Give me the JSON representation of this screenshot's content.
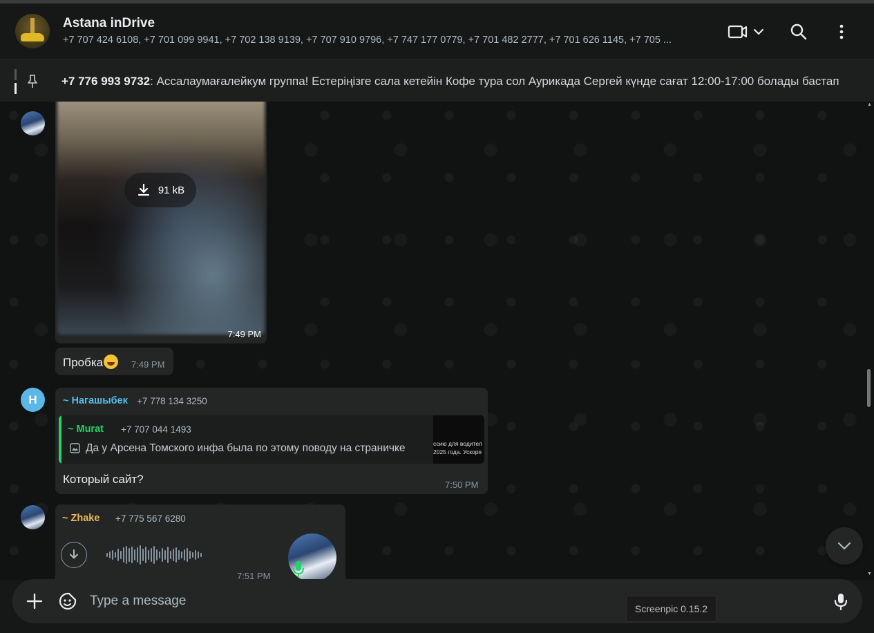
{
  "header": {
    "title": "Astana inDrive",
    "members": "+7 707 424 6108, +7 701 099 9941, +7 702 138 9139, +7 707 910 9796, +7 747 177 0779, +7 701 482 2777, +7 701 626 1145, +7 705 ...",
    "buttons": [
      "video-call",
      "search",
      "menu"
    ]
  },
  "pinned": {
    "sender": "+7 776 993 9732",
    "text": ": Ассалаумағалейкум группа! Естеріңізге сала кетейін  Кофе тура сол Аурикада  Сергей күнде сағат 12:00-17:00 болады бастап"
  },
  "messages": {
    "image": {
      "size": "91 kB",
      "time": "7:49 PM"
    },
    "text1": {
      "text": "Пробка",
      "emoji": "laughing-emoji",
      "time": "7:49 PM"
    },
    "reply": {
      "avatar_letter": "Н",
      "sender": "~ Нагашыбек",
      "sender_phone": "+7 778 134 3250",
      "sender_color": "#53bdeb",
      "quoted_sender": "~ Murat",
      "quoted_phone": "+7 707 044 1493",
      "quoted_color": "#25d366",
      "quoted_text": "Да у Арсена Томского инфа была по этому поводу на страничке",
      "thumb_line1": "ссию для водител",
      "thumb_line2": "2025 года. Ускоря",
      "text": "Который сайт?",
      "time": "7:50 PM"
    },
    "voice": {
      "sender": "~ Zhake",
      "sender_phone": "+7 775 567 6280",
      "sender_color": "#e9b658",
      "time": "7:51 PM"
    }
  },
  "composer": {
    "placeholder": "Type a message",
    "tooltip": "Screenpic 0.15.2"
  }
}
